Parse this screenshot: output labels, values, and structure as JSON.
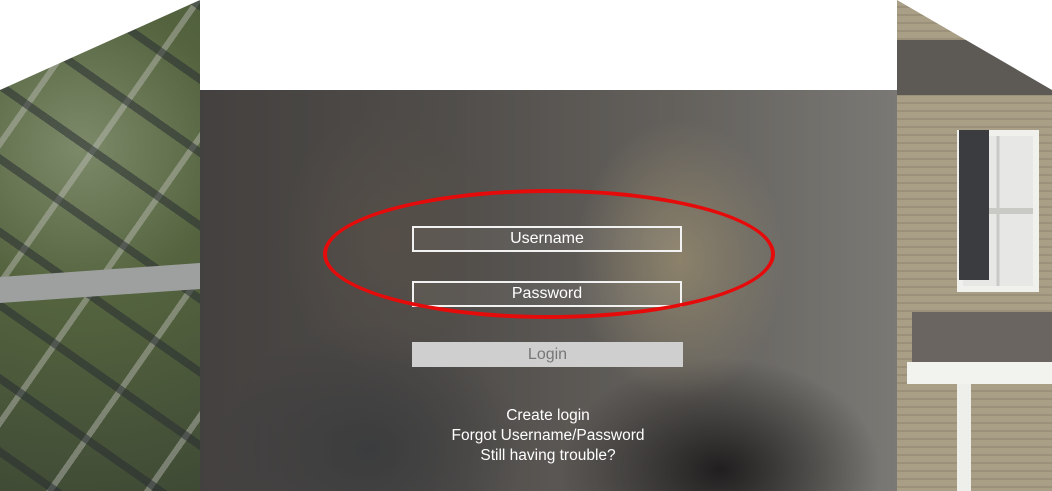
{
  "login_form": {
    "username_placeholder": "Username",
    "password_placeholder": "Password",
    "login_label": "Login"
  },
  "links": {
    "create_login": "Create login",
    "forgot": "Forgot Username/Password",
    "trouble": "Still having trouble?"
  },
  "colors": {
    "annotation_ring": "#e60b0b",
    "login_button_bg": "#cfcfcf",
    "field_border": "#f2f2f2"
  },
  "background_images": [
    "aerial-neighborhood-photo",
    "couple-at-laptop-photo",
    "house-facade-photo"
  ]
}
